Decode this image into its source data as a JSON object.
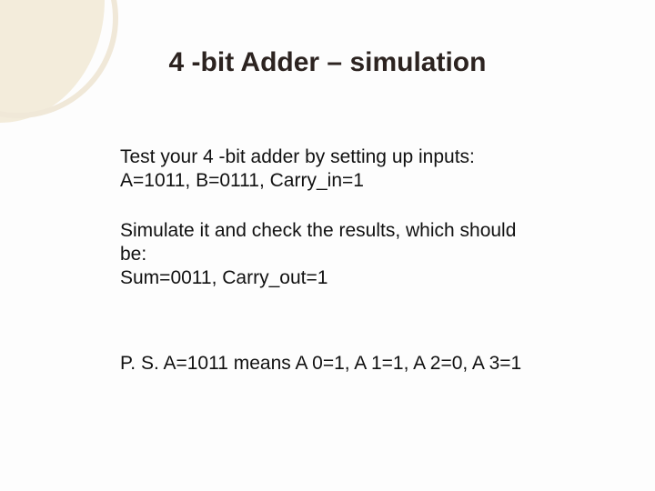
{
  "title": "4 -bit  Adder – simulation",
  "p1": {
    "l1": "Test your 4 -bit adder by setting up inputs:",
    "l2": "A=1011,  B=0111,  Carry_in=1"
  },
  "p2": {
    "l1": "Simulate it and check the results, which should",
    "l2": "be:",
    "l3": "Sum=0011,  Carry_out=1"
  },
  "ps": "P. S.  A=1011 means A 0=1, A 1=1, A 2=0, A 3=1"
}
